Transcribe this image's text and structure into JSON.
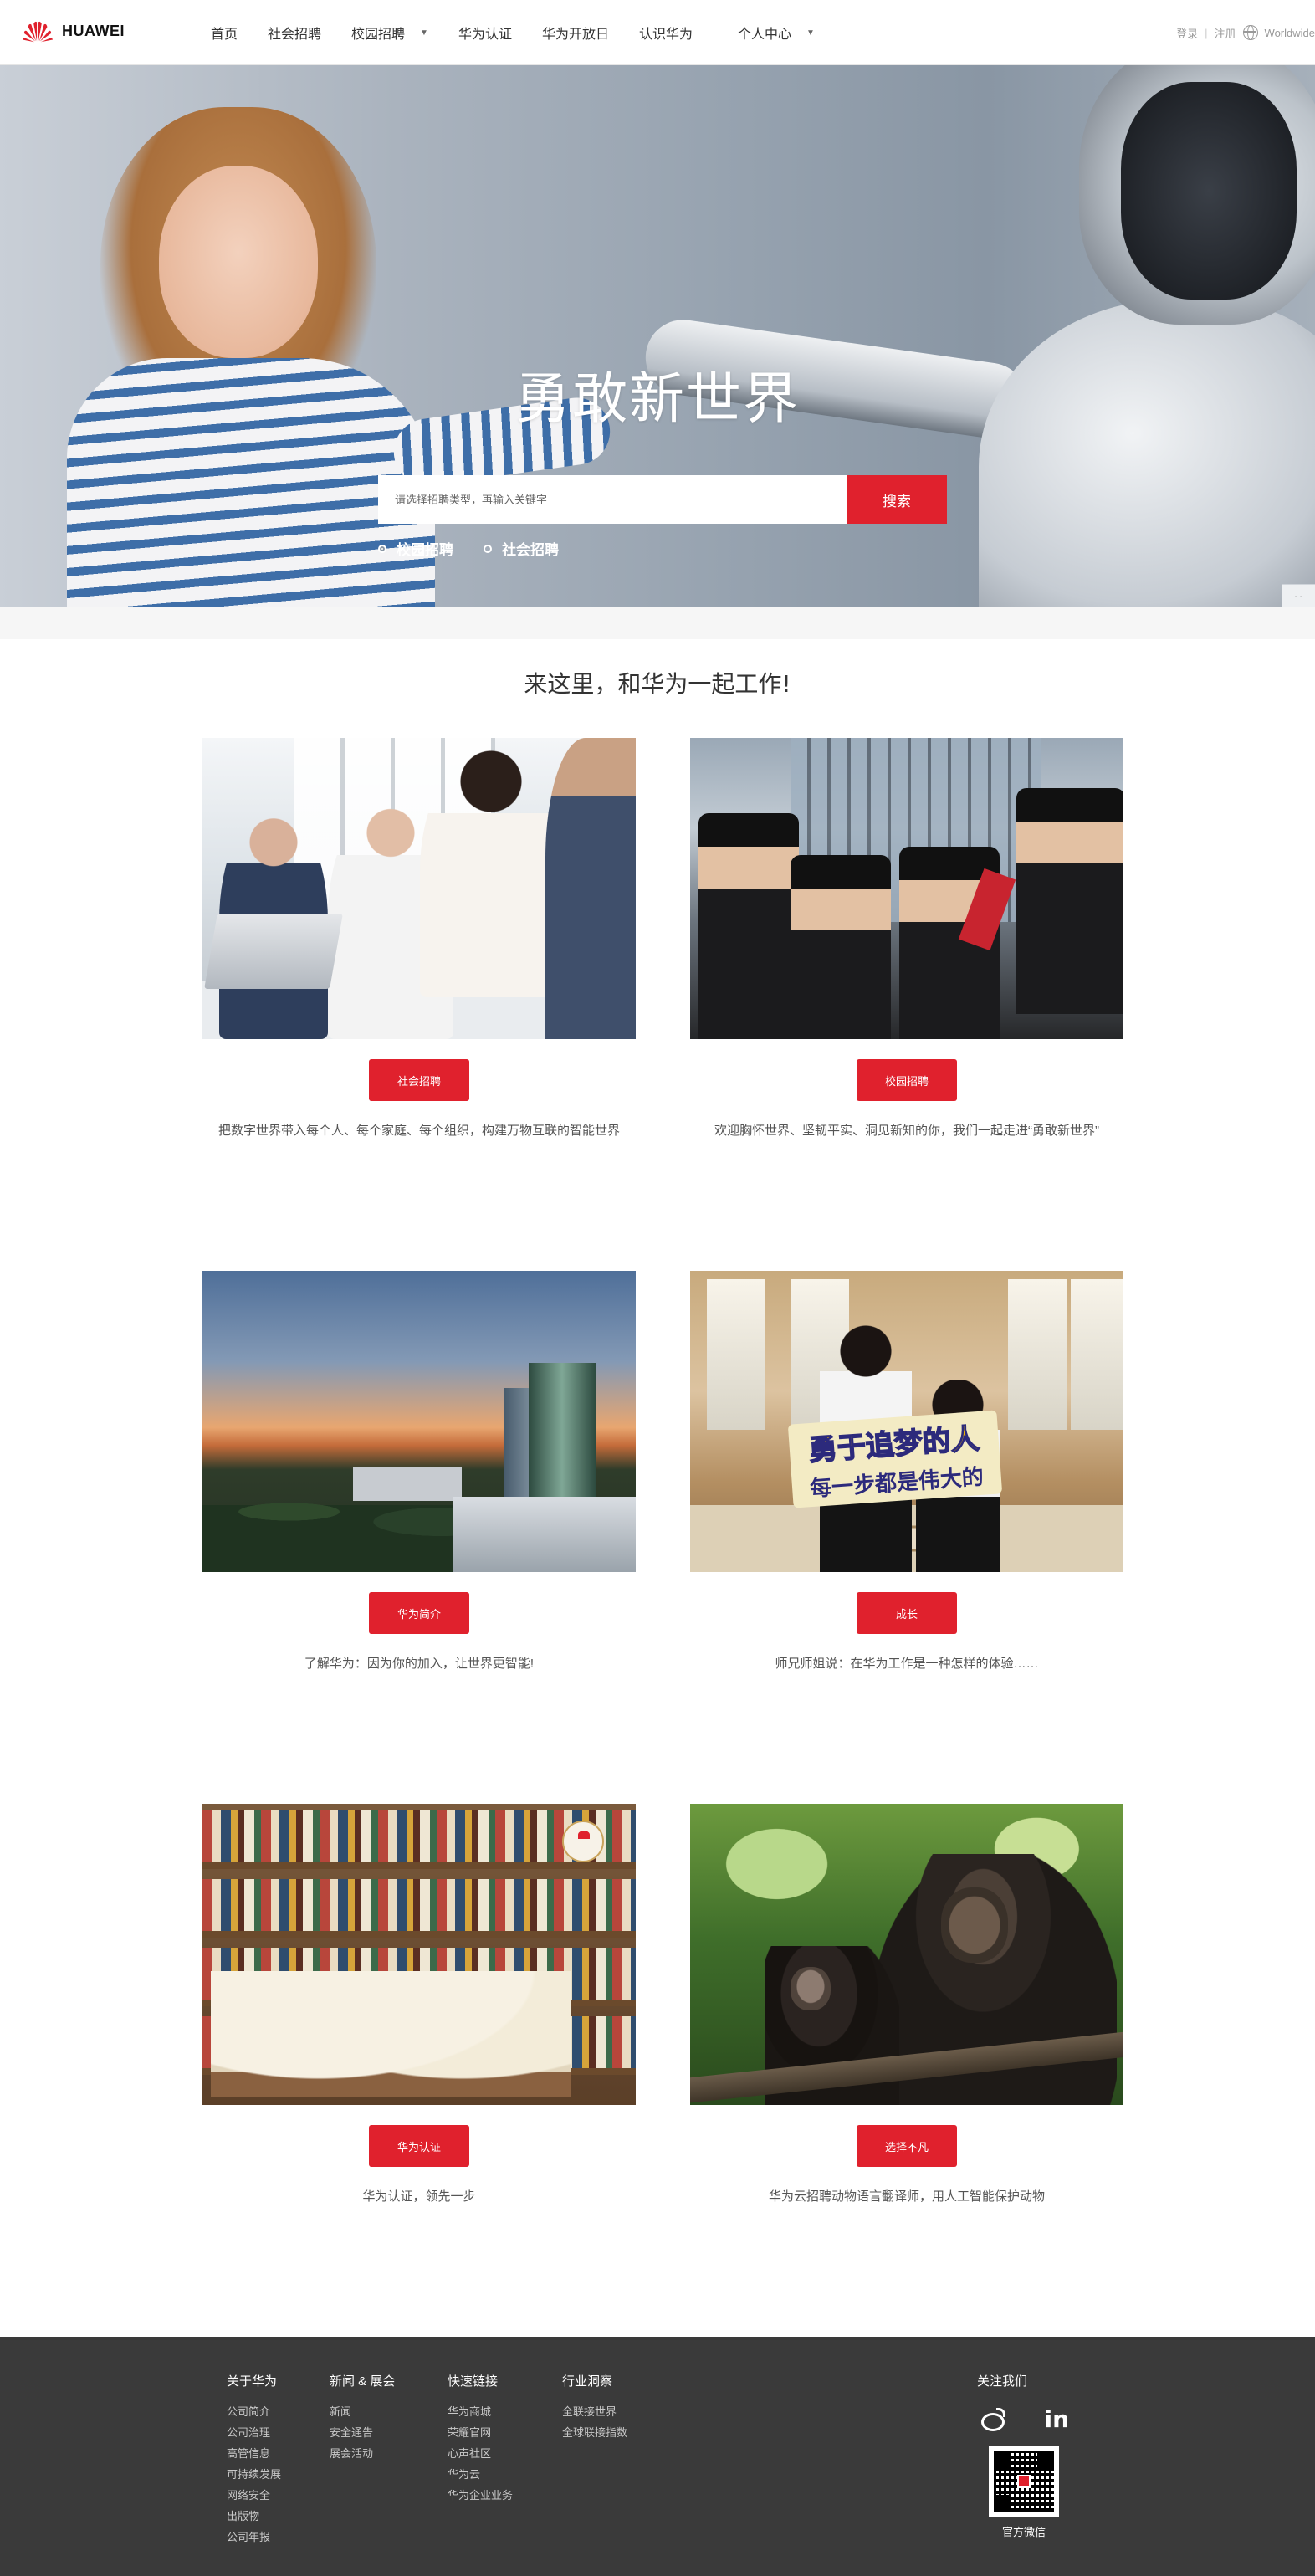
{
  "header": {
    "logo_text": "HUAWEI",
    "nav": [
      {
        "label": "首页"
      },
      {
        "label": "社会招聘"
      },
      {
        "label": "校园招聘",
        "has_dropdown": true
      },
      {
        "label": "华为认证"
      },
      {
        "label": "华为开放日"
      },
      {
        "label": "认识华为"
      },
      {
        "label": "个人中心",
        "has_dropdown": true
      }
    ],
    "login": "登录",
    "separator": "|",
    "register": "注册",
    "region": "Worldwide"
  },
  "hero": {
    "title": "勇敢新世界",
    "search_placeholder": "请选择招聘类型，再输入关键字",
    "search_button": "搜索",
    "radio_options": [
      {
        "label": "校园招聘",
        "checked": true
      },
      {
        "label": "社会招聘",
        "checked": false
      }
    ]
  },
  "main": {
    "section_title": "来这里，和华为一起工作!",
    "cards": [
      {
        "button": "社会招聘",
        "desc": "把数字世界带入每个人、每个家庭、每个组织，构建万物互联的智能世界",
        "image": "office-meeting"
      },
      {
        "button": "校园招聘",
        "desc": "欢迎胸怀世界、坚韧平实、洞见新知的你，我们一起走进“勇敢新世界”",
        "image": "graduates"
      },
      {
        "button": "华为简介",
        "desc": "了解华为：因为你的加入，让世界更智能!",
        "image": "campus-sunset"
      },
      {
        "button": "成长",
        "desc": "师兄师姐说：在华为工作是一种怎样的体验……",
        "image": "lobby-sign",
        "sign_line1": "勇于追梦的人",
        "sign_line2": "每一步都是伟大的"
      },
      {
        "button": "华为认证",
        "desc": "华为认证，领先一步",
        "image": "library-books"
      },
      {
        "button": "选择不凡",
        "desc": "华为云招聘动物语言翻译师，用人工智能保护动物",
        "image": "monkeys"
      }
    ]
  },
  "footer": {
    "columns": [
      {
        "title": "关于华为",
        "links": [
          "公司简介",
          "公司治理",
          "高管信息",
          "可持续发展",
          "网络安全",
          "出版物",
          "公司年报"
        ]
      },
      {
        "title": "新闻 & 展会",
        "links": [
          "新闻",
          "安全通告",
          "展会活动"
        ]
      },
      {
        "title": "快速链接",
        "links": [
          "华为商城",
          "荣耀官网",
          "心声社区",
          "华为云",
          "华为企业业务"
        ]
      },
      {
        "title": "行业洞察",
        "links": [
          "全联接世界",
          "全球联接指数"
        ]
      }
    ],
    "follow_title": "关注我们",
    "linkedin_text": "in",
    "qr_caption": "官方微信"
  },
  "colors": {
    "brand_red": "#e0212d",
    "footer_bg": "#3a3a3a"
  }
}
